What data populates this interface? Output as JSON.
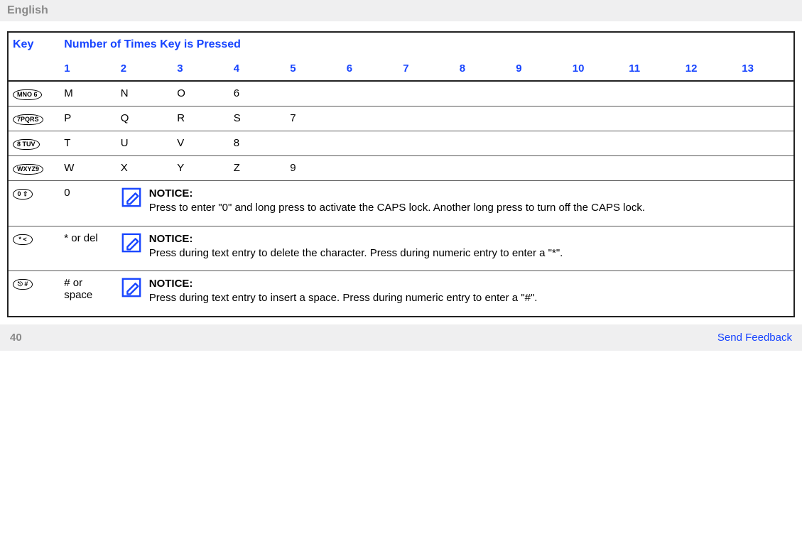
{
  "header": {
    "language": "English"
  },
  "table": {
    "key_header": "Key",
    "presses_header": "Number of Times Key is Pressed",
    "press_labels": [
      "1",
      "2",
      "3",
      "4",
      "5",
      "6",
      "7",
      "8",
      "9",
      "10",
      "11",
      "12",
      "13"
    ],
    "rows": [
      {
        "key_label": "MNO 6",
        "cells": [
          "M",
          "N",
          "O",
          "6",
          "",
          "",
          "",
          "",
          "",
          "",
          "",
          "",
          ""
        ]
      },
      {
        "key_label": "7PQRS",
        "cells": [
          "P",
          "Q",
          "R",
          "S",
          "7",
          "",
          "",
          "",
          "",
          "",
          "",
          "",
          ""
        ]
      },
      {
        "key_label": "8 TUV",
        "cells": [
          "T",
          "U",
          "V",
          "8",
          "",
          "",
          "",
          "",
          "",
          "",
          "",
          "",
          ""
        ]
      },
      {
        "key_label": "WXYZ9",
        "cells": [
          "W",
          "X",
          "Y",
          "Z",
          "9",
          "",
          "",
          "",
          "",
          "",
          "",
          "",
          ""
        ]
      }
    ],
    "notice_rows": [
      {
        "key_label": "0 ⇧",
        "first": "0",
        "title": "NOTICE:",
        "body": "Press to enter \"0\" and long press to activate the CAPS lock. Another long press to turn off the CAPS lock."
      },
      {
        "key_label": "* <",
        "first": "* or del",
        "title": "NOTICE:",
        "body": "Press during text entry to delete the character. Press during numeric entry to enter a \"*\"."
      },
      {
        "key_label": "⎋ #",
        "first": "# or space",
        "title": "NOTICE:",
        "body": "Press during text entry to insert a space. Press during numeric entry to enter a \"#\"."
      }
    ]
  },
  "footer": {
    "page": "40",
    "feedback": "Send Feedback"
  }
}
